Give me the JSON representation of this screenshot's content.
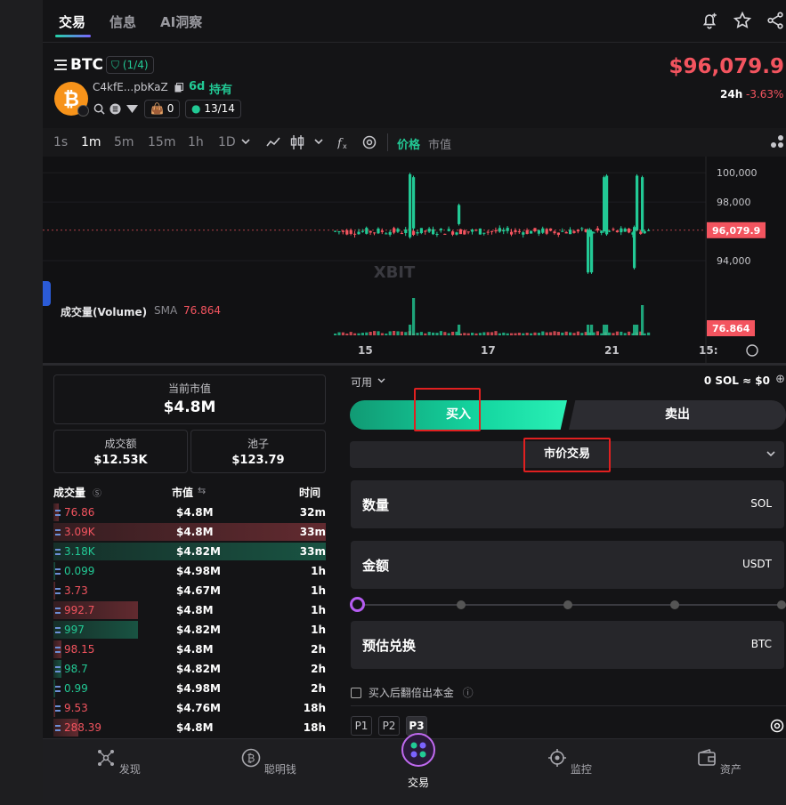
{
  "tabs": [
    "交易",
    "信息",
    "AI洞察"
  ],
  "token": {
    "symbol": "BTC",
    "shield_badge": "(1/4)",
    "address": "C4kfE...pbKaZ",
    "age": "6d",
    "hold_label": "持有",
    "holders_count": "0",
    "progress": "13/14",
    "price": "$96,079.9",
    "change_period": "24h",
    "change": "-3.63%"
  },
  "chart_toolbar": {
    "timeframes": [
      "1s",
      "1m",
      "5m",
      "15m",
      "1h",
      "1D"
    ],
    "active_timeframe": "1m",
    "mode_price": "价格",
    "mode_mcap": "市值"
  },
  "chart_data": {
    "type": "candlestick",
    "x_ticks": [
      "15",
      "17",
      "21",
      "15:"
    ],
    "y_ticks": [
      "100,000",
      "98,000",
      "96,079.9",
      "94,000"
    ],
    "ylim": [
      92000,
      100500
    ],
    "last_price": 96079.9,
    "watermark": "XBIT",
    "volume_label": "成交量(Volume)",
    "volume_sma_label": "SMA",
    "volume_sma_value": "76.864",
    "volume_last": "76.864"
  },
  "stats": {
    "market_cap_label": "当前市值",
    "market_cap": "$4.8M",
    "volume_label": "成交额",
    "volume": "$12.53K",
    "pool_label": "池子",
    "pool": "$123.79"
  },
  "trades": {
    "headers": [
      "成交量",
      "市值",
      "时间"
    ],
    "rows": [
      {
        "vol": "76.86",
        "side": "sell",
        "mc": "$4.8M",
        "time": "32m",
        "bar": 0.02
      },
      {
        "vol": "3.09K",
        "side": "sell",
        "mc": "$4.8M",
        "time": "33m",
        "bar": 1.0
      },
      {
        "vol": "3.18K",
        "side": "buy",
        "mc": "$4.82M",
        "time": "33m",
        "bar": 1.0
      },
      {
        "vol": "0.099",
        "side": "buy",
        "mc": "$4.98M",
        "time": "1h",
        "bar": 0.0
      },
      {
        "vol": "3.73",
        "side": "sell",
        "mc": "$4.67M",
        "time": "1h",
        "bar": 0.0
      },
      {
        "vol": "992.7",
        "side": "sell",
        "mc": "$4.8M",
        "time": "1h",
        "bar": 0.31
      },
      {
        "vol": "997",
        "side": "buy",
        "mc": "$4.82M",
        "time": "1h",
        "bar": 0.31
      },
      {
        "vol": "98.15",
        "side": "sell",
        "mc": "$4.8M",
        "time": "2h",
        "bar": 0.03
      },
      {
        "vol": "98.7",
        "side": "buy",
        "mc": "$4.82M",
        "time": "2h",
        "bar": 0.03
      },
      {
        "vol": "0.99",
        "side": "buy",
        "mc": "$4.98M",
        "time": "2h",
        "bar": 0.0
      },
      {
        "vol": "9.53",
        "side": "sell",
        "mc": "$4.76M",
        "time": "18h",
        "bar": 0.0
      },
      {
        "vol": "288.39",
        "side": "sell",
        "mc": "$4.8M",
        "time": "18h",
        "bar": 0.09
      }
    ]
  },
  "trade_panel": {
    "available_label": "可用",
    "balance": "0 SOL ≈ $0",
    "buy_label": "买入",
    "sell_label": "卖出",
    "order_type": "市价交易",
    "amount_label": "数量",
    "amount_unit": "SOL",
    "total_label": "金额",
    "total_unit": "USDT",
    "estimate_label": "预估兑换",
    "estimate_unit": "BTC",
    "double_principal_label": "买入后翻倍出本金",
    "presets": [
      "P1",
      "P2",
      "P3"
    ],
    "active_preset": "P3"
  },
  "bottom_nav": [
    "发现",
    "聪明钱",
    "交易",
    "监控",
    "资产"
  ],
  "colors": {
    "up": "#22c995",
    "down": "#f3545f",
    "accent": "#b55cf0"
  }
}
